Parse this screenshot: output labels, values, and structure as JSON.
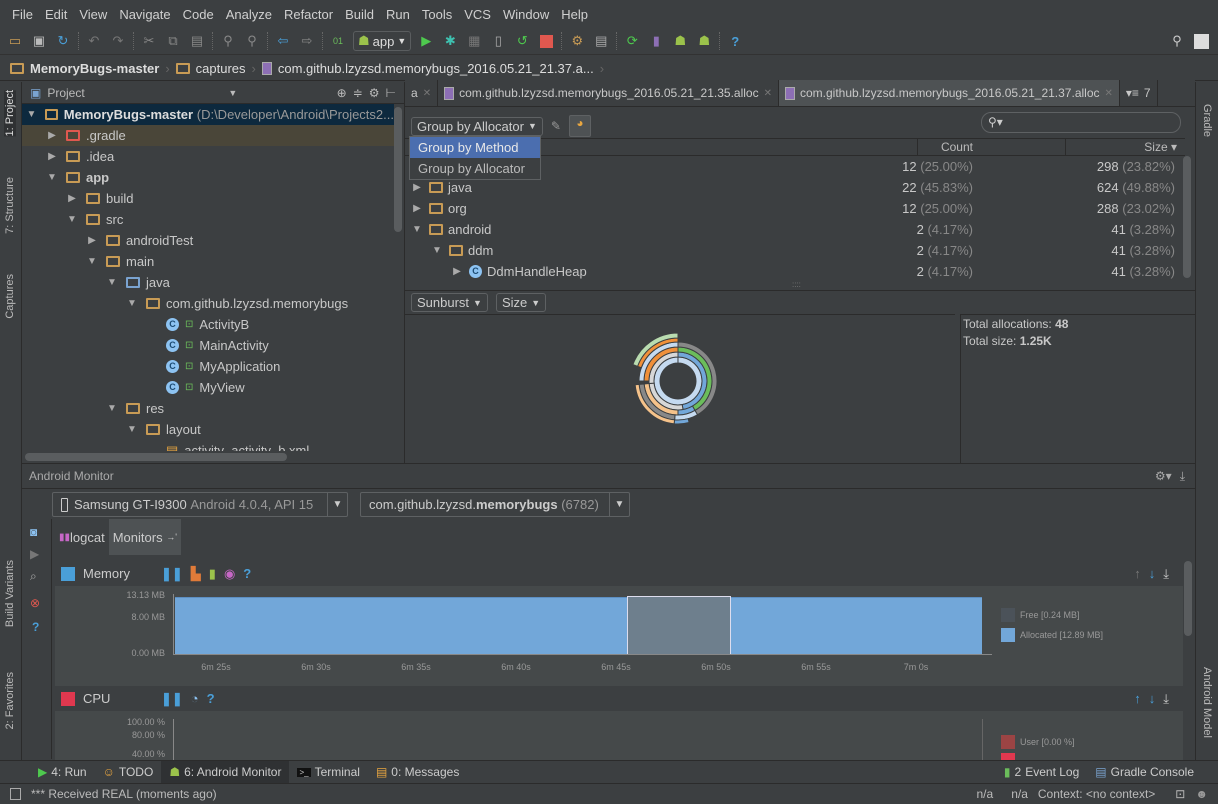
{
  "menu": [
    "File",
    "Edit",
    "View",
    "Navigate",
    "Code",
    "Analyze",
    "Refactor",
    "Build",
    "Run",
    "Tools",
    "VCS",
    "Window",
    "Help"
  ],
  "toolbar": {
    "run_config": "app"
  },
  "breadcrumb": [
    "MemoryBugs-master",
    "captures",
    "com.github.lzyzsd.memorybugs_2016.05.21_21.37.a..."
  ],
  "left_stripe": [
    "1: Project",
    "7: Structure",
    "Captures",
    "Build Variants",
    "2: Favorites"
  ],
  "right_stripe": [
    "Gradle",
    "Android Model"
  ],
  "project": {
    "title": "Project",
    "root": {
      "name": "MemoryBugs-master",
      "path": "(D:\\Developer\\Android\\Projects2..."
    },
    "items": [
      {
        "label": ".gradle",
        "depth": 1,
        "state": "collapsed"
      },
      {
        "label": ".idea",
        "depth": 1,
        "state": "collapsed"
      },
      {
        "label": "app",
        "depth": 1,
        "state": "expanded"
      },
      {
        "label": "build",
        "depth": 2,
        "state": "collapsed"
      },
      {
        "label": "src",
        "depth": 2,
        "state": "expanded"
      },
      {
        "label": "androidTest",
        "depth": 3,
        "state": "collapsed"
      },
      {
        "label": "main",
        "depth": 3,
        "state": "expanded"
      },
      {
        "label": "java",
        "depth": 4,
        "state": "expanded"
      },
      {
        "label": "com.github.lzyzsd.memorybugs",
        "depth": 5,
        "state": "expanded"
      },
      {
        "label": "ActivityB",
        "depth": 6,
        "state": "class"
      },
      {
        "label": "MainActivity",
        "depth": 6,
        "state": "class"
      },
      {
        "label": "MyApplication",
        "depth": 6,
        "state": "class"
      },
      {
        "label": "MyView",
        "depth": 6,
        "state": "class"
      },
      {
        "label": "res",
        "depth": 4,
        "state": "expanded"
      },
      {
        "label": "layout",
        "depth": 5,
        "state": "expanded"
      },
      {
        "label": "activity_activity_b.xml",
        "depth": 6,
        "state": "file"
      }
    ]
  },
  "editor": {
    "tabs": [
      {
        "label": "a",
        "active": false
      },
      {
        "label": "com.github.lzyzsd.memorybugs_2016.05.21_21.35.alloc",
        "active": false
      },
      {
        "label": "com.github.lzyzsd.memorybugs_2016.05.21_21.37.alloc",
        "active": true
      }
    ],
    "tab_overflow": "7",
    "group_combo": "Group by Allocator",
    "group_options": [
      "Group by Method",
      "Group by Allocator"
    ],
    "group_highlighted": "Group by Method",
    "columns": {
      "count": "Count",
      "size": "Size ▾"
    },
    "rows": [
      {
        "name": "",
        "depth": 0,
        "count": "12",
        "count_pct": "(25.00%)",
        "size": "298",
        "size_pct": "(23.82%)",
        "state": "none"
      },
      {
        "name": "java",
        "depth": 0,
        "count": "22",
        "count_pct": "(45.83%)",
        "size": "624",
        "size_pct": "(49.88%)",
        "state": "collapsed"
      },
      {
        "name": "org",
        "depth": 0,
        "count": "12",
        "count_pct": "(25.00%)",
        "size": "288",
        "size_pct": "(23.02%)",
        "state": "collapsed"
      },
      {
        "name": "android",
        "depth": 0,
        "count": "2",
        "count_pct": "(4.17%)",
        "size": "41",
        "size_pct": "(3.28%)",
        "state": "expanded"
      },
      {
        "name": "ddm",
        "depth": 1,
        "count": "2",
        "count_pct": "(4.17%)",
        "size": "41",
        "size_pct": "(3.28%)",
        "state": "expanded"
      },
      {
        "name": "DdmHandleHeap",
        "depth": 2,
        "count": "2",
        "count_pct": "(4.17%)",
        "size": "41",
        "size_pct": "(3.28%)",
        "state": "class"
      }
    ],
    "chart_combo": "Sunburst",
    "size_combo": "Size",
    "summary": {
      "alloc_label": "Total allocations:",
      "alloc_value": "48",
      "size_label": "Total size:",
      "size_value": "1.25K"
    }
  },
  "monitor": {
    "title": "Android Monitor",
    "device": {
      "name": "Samsung GT-I9300",
      "detail": "Android 4.0.4, API 15"
    },
    "process": {
      "prefix": "com.github.lzyzsd.",
      "name": "memorybugs",
      "pid": "(6782)"
    },
    "tabs": [
      "logcat",
      "Monitors"
    ],
    "memory": {
      "title": "Memory"
    },
    "cpu": {
      "title": "CPU"
    }
  },
  "chart_data": [
    {
      "type": "area",
      "title": "Memory",
      "ylabels": [
        "13.13 MB",
        "8.00 MB",
        "0.00 MB"
      ],
      "ylim": [
        0,
        13.13
      ],
      "xlabels": [
        "6m 25s",
        "6m 30s",
        "6m 35s",
        "6m 40s",
        "6m 45s",
        "6m 50s",
        "6m 55s",
        "7m 0s"
      ],
      "series": [
        {
          "name": "Free [0.24 MB]",
          "color": "#5f6e7c"
        },
        {
          "name": "Allocated [12.89 MB]",
          "color": "#72a7d9"
        }
      ],
      "allocated_mb": 12.89,
      "free_mb": 0.24
    },
    {
      "type": "area",
      "title": "CPU",
      "ylabels": [
        "100.00 %",
        "80.00 %",
        "40.00 %"
      ],
      "series": [
        {
          "name": "User [0.00 %]",
          "color": "#9b4444"
        }
      ]
    }
  ],
  "bottom_tools": [
    {
      "label": "4: Run",
      "active": false
    },
    {
      "label": "TODO",
      "active": false
    },
    {
      "label": "6: Android Monitor",
      "active": true
    },
    {
      "label": "Terminal",
      "active": false
    },
    {
      "label": "0: Messages",
      "active": false
    }
  ],
  "bottom_right": [
    "Event Log",
    "Gradle Console"
  ],
  "event_badge": "2",
  "status": {
    "message": "*** Received REAL (moments ago)",
    "pos1": "n/a",
    "pos2": "n/a",
    "context": "Context: <no context>"
  }
}
